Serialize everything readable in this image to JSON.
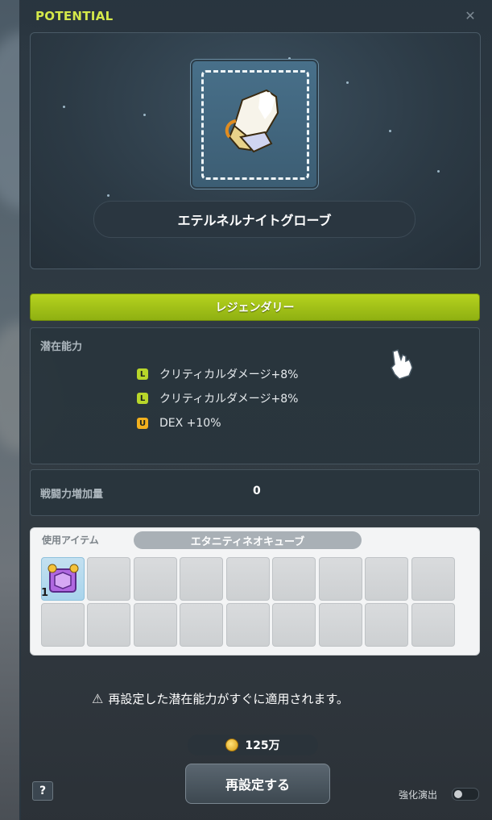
{
  "window": {
    "title": "POTENTIAL",
    "close_icon": "close-icon"
  },
  "item": {
    "name": "エテルネルナイトグローブ",
    "icon": "glove-icon"
  },
  "grade": {
    "label": "レジェンダリー",
    "color": "#a6c41a"
  },
  "potential": {
    "label": "潜在能力",
    "lines": [
      {
        "badge": "L",
        "text": "クリティカルダメージ+8%"
      },
      {
        "badge": "L",
        "text": "クリティカルダメージ+8%"
      },
      {
        "badge": "U",
        "text": "DEX +10%"
      }
    ]
  },
  "power": {
    "label": "戦闘力増加量",
    "value": "0"
  },
  "use_items": {
    "label": "使用アイテム",
    "selected": "エタニティネオキューブ",
    "cube_count": "1"
  },
  "warning": {
    "icon": "warning-icon",
    "text": "再設定した潜在能力がすぐに適用されます。"
  },
  "cost": {
    "icon": "coin-icon",
    "amount": "125万"
  },
  "actions": {
    "reset_label": "再設定する",
    "help_label": "?",
    "effect_label": "強化演出",
    "effect_on": false
  }
}
